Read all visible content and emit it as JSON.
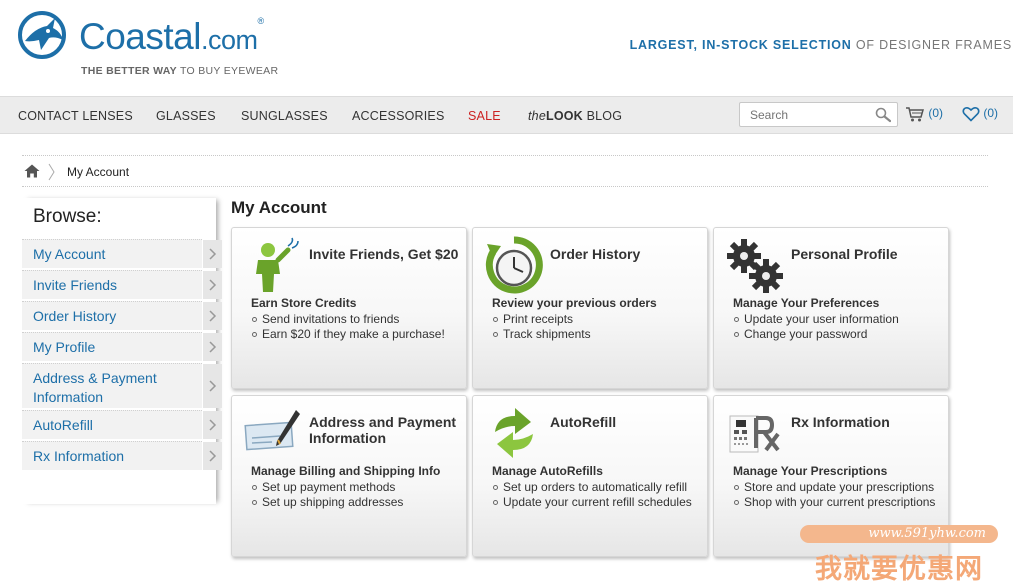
{
  "header": {
    "logo_name": "Coastal",
    "logo_suffix": ".com",
    "logo_trademark": "®",
    "tagline_bold": "THE BETTER WAY",
    "tagline_rest": " TO BUY EYEWEAR",
    "slogan_bold": "LARGEST, IN-STOCK SELECTION",
    "slogan_rest": " OF DESIGNER FRAMES",
    "brand_color": "#1d6fa8"
  },
  "nav": {
    "items": [
      {
        "label": "CONTACT LENSES"
      },
      {
        "label": "GLASSES"
      },
      {
        "label": "SUNGLASSES"
      },
      {
        "label": "ACCESSORIES"
      },
      {
        "label": "SALE"
      }
    ],
    "blog_prefix": "the",
    "blog_bold": "LOOK",
    "blog_rest": " BLOG",
    "search_placeholder": "Search",
    "cart_count": "(0)",
    "wishlist_count": "(0)"
  },
  "breadcrumb": {
    "current": "My Account"
  },
  "sidebar": {
    "title": "Browse:",
    "items": [
      {
        "label": "My Account"
      },
      {
        "label": "Invite Friends"
      },
      {
        "label": "Order History"
      },
      {
        "label": "My Profile"
      },
      {
        "label": "Address & Payment Information"
      },
      {
        "label": "AutoRefill"
      },
      {
        "label": "Rx Information"
      }
    ]
  },
  "main": {
    "title": "My Account",
    "cards": [
      {
        "title": "Invite Friends, Get $20",
        "subtitle": "Earn Store Credits",
        "bullets": [
          "Send invitations to friends",
          "Earn $20 if they make a purchase!"
        ],
        "icon": "person-invite-icon"
      },
      {
        "title": "Order History",
        "subtitle": "Review your previous orders",
        "bullets": [
          "Print receipts",
          "Track shipments"
        ],
        "icon": "clock-history-icon"
      },
      {
        "title": "Personal Profile",
        "subtitle": "Manage Your Preferences",
        "bullets": [
          "Update your user information",
          "Change your password"
        ],
        "icon": "gears-icon"
      },
      {
        "title": "Address and Payment Information",
        "subtitle": "Manage Billing and Shipping Info",
        "bullets": [
          "Set up payment methods",
          "Set up shipping addresses"
        ],
        "icon": "check-pen-icon"
      },
      {
        "title": "AutoRefill",
        "subtitle": "Manage AutoRefills",
        "bullets": [
          "Set up orders to automatically refill",
          "Update your current refill schedules"
        ],
        "icon": "refill-arrows-icon"
      },
      {
        "title": "Rx Information",
        "subtitle": "Manage Your Prescriptions",
        "bullets": [
          "Store and update your prescriptions",
          "Shop with your current prescriptions"
        ],
        "icon": "eye-chart-rx-icon"
      }
    ]
  },
  "watermark": {
    "url": "www.591yhw.com",
    "text": "我就要优惠网"
  }
}
